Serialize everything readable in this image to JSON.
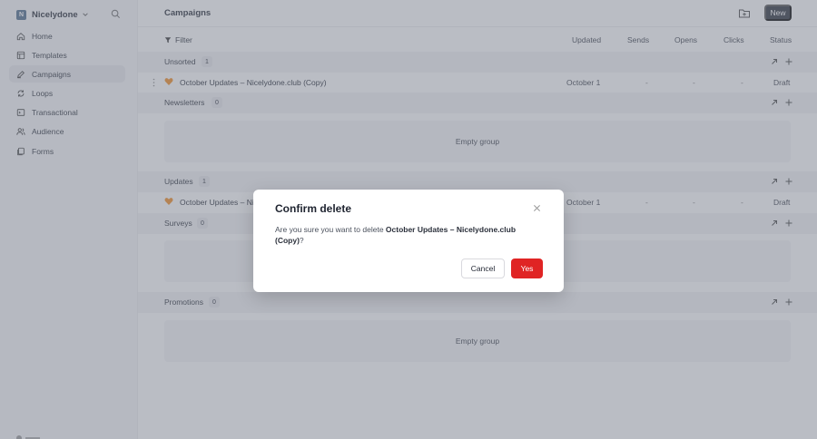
{
  "workspace": {
    "initial": "N",
    "name": "Nicelydone"
  },
  "sidebar": {
    "items": [
      {
        "label": "Home",
        "icon": "home-icon"
      },
      {
        "label": "Templates",
        "icon": "template-icon"
      },
      {
        "label": "Campaigns",
        "icon": "pencil-icon",
        "active": true
      },
      {
        "label": "Loops",
        "icon": "loop-icon"
      },
      {
        "label": "Transactional",
        "icon": "transactional-icon"
      },
      {
        "label": "Audience",
        "icon": "users-icon"
      },
      {
        "label": "Forms",
        "icon": "forms-icon"
      }
    ]
  },
  "header": {
    "title": "Campaigns",
    "new_label": "New"
  },
  "toolbar": {
    "filter_label": "Filter"
  },
  "columns": [
    "Updated",
    "Sends",
    "Opens",
    "Clicks",
    "Status"
  ],
  "groups": [
    {
      "name": "Unsorted",
      "count": "1"
    },
    {
      "name": "Newsletters",
      "count": "0"
    },
    {
      "name": "Updates",
      "count": "1"
    },
    {
      "name": "Surveys",
      "count": "0"
    },
    {
      "name": "Promotions",
      "count": "0"
    }
  ],
  "campaigns": [
    {
      "name": "October Updates – Nicelydone.club (Copy)",
      "updated": "October 1",
      "sends": "-",
      "opens": "-",
      "clicks": "-",
      "status": "Draft"
    },
    {
      "name": "October Updates – Nicelydone.club (Copy)",
      "updated": "October 1",
      "sends": "-",
      "opens": "-",
      "clicks": "-",
      "status": "Draft"
    }
  ],
  "empty_label": "Empty group",
  "modal": {
    "title": "Confirm delete",
    "message_prefix": "Are you sure you want to delete ",
    "message_bold": "October Updates – Nicelydone.club (Copy)",
    "message_suffix": "?",
    "cancel_label": "Cancel",
    "confirm_label": "Yes"
  },
  "colors": {
    "accent": "#2b303b",
    "danger": "#e02424",
    "overlay": "#767c89"
  }
}
